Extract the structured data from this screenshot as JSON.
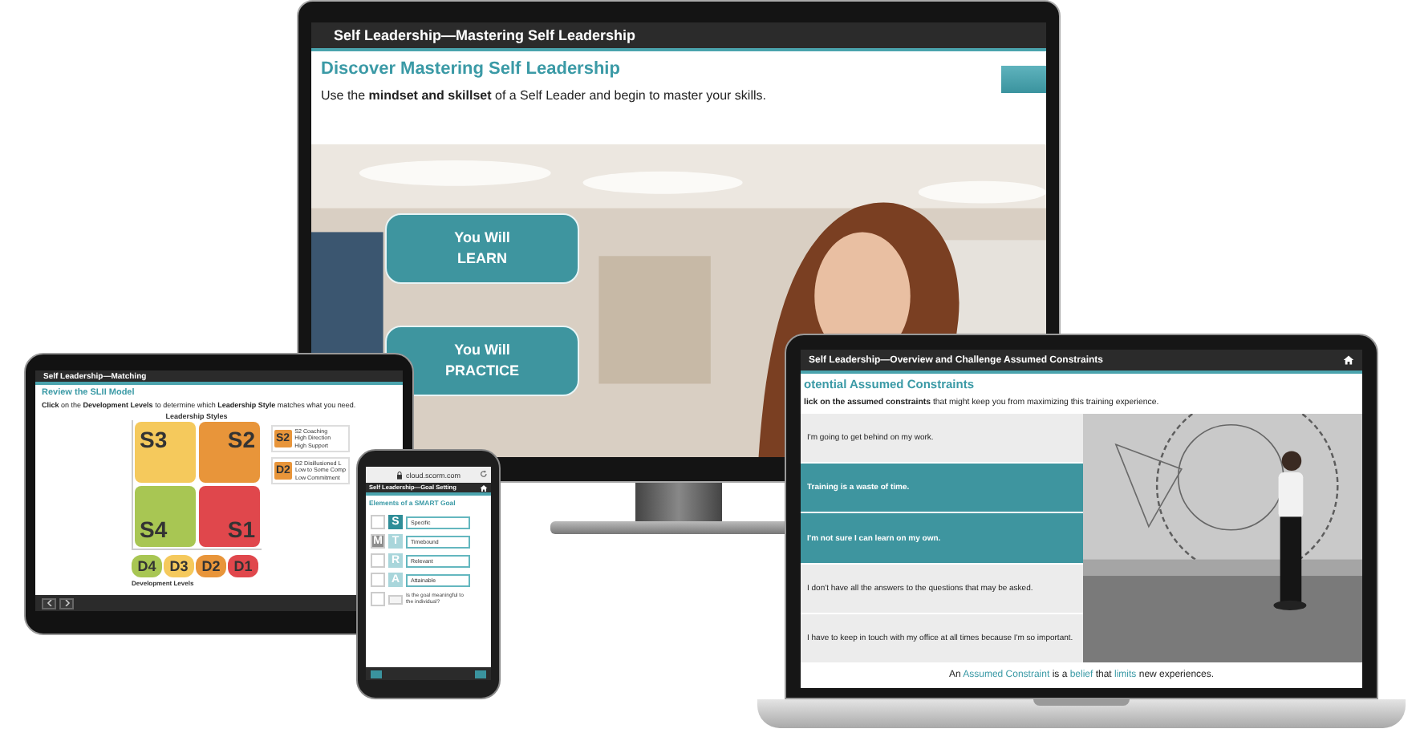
{
  "monitor": {
    "title": "Self Leadership—Mastering Self Leadership",
    "heading": "Discover Mastering Self Leadership",
    "intro": "Use the **mindset and skillset** of a Self Leader and begin to master your skills.",
    "buttons": [
      {
        "label": "You Will\nLEARN"
      },
      {
        "label": "You Will\nPRACTICE"
      }
    ]
  },
  "tablet": {
    "title": "Self Leadership—Matching",
    "heading": "Review the SLII Model",
    "instruction": "**Click** on the **Development Levels** to determine which **Leadership Style** matches what you need.",
    "chart_title": "Leadership Styles",
    "styles": [
      {
        "label": "S3",
        "color": "#f5c95c"
      },
      {
        "label": "S2",
        "color": "#e8953a"
      },
      {
        "label": "S4",
        "color": "#a8c653"
      },
      {
        "label": "S1",
        "color": "#e0474c"
      }
    ],
    "legend": [
      {
        "badge": "S2",
        "color": "#e8953a",
        "text": "S2 Coaching\nHigh Direction\nHigh Support"
      },
      {
        "badge": "D2",
        "color": "#e8953a",
        "text": "D2 Disillusioned L\nLow to Some Comp\nLow Commitment"
      }
    ],
    "levels": [
      {
        "label": "D4",
        "color": "#a8c653"
      },
      {
        "label": "D3",
        "color": "#f5c95c"
      },
      {
        "label": "D2",
        "color": "#e8953a"
      },
      {
        "label": "D1",
        "color": "#e0474c"
      }
    ],
    "axis_label": "Development Levels"
  },
  "phone": {
    "url": "cloud.scorm.com",
    "title": "Self Leadership—Goal Setting",
    "heading": "Elements of a SMART Goal",
    "rows": [
      {
        "kind": "pair",
        "letter": "S",
        "answer": "Specific",
        "highlighted": true
      },
      {
        "kind": "pair",
        "slot": "M",
        "letter": "T",
        "answer": "Timebound",
        "highlighted": false
      },
      {
        "kind": "pair",
        "letter": "R",
        "answer": "Relevant",
        "highlighted": false
      },
      {
        "kind": "pair",
        "letter": "A",
        "answer": "Attainable",
        "highlighted": false
      },
      {
        "kind": "question",
        "text": "Is the goal meaningful to the individual?"
      }
    ]
  },
  "laptop": {
    "title": "Self Leadership—Overview and Challenge Assumed Constraints",
    "heading": "otential Assumed Constraints",
    "instruction": "**lick on the assumed constraints** that might keep you from maximizing this training experience.",
    "items": [
      {
        "text": "I'm going to get behind on my work.",
        "selected": false
      },
      {
        "text": "Training is a waste of time.",
        "selected": true
      },
      {
        "text": "I'm not sure I can learn on my own.",
        "selected": true
      },
      {
        "text": "I don't have all the answers to the questions that may be asked.",
        "selected": false
      },
      {
        "text": "I have to keep in touch with my office at all times because I'm so important.",
        "selected": false
      }
    ],
    "footer": "An **Assumed Constraint** is a **belief** that **limits** new experiences."
  }
}
